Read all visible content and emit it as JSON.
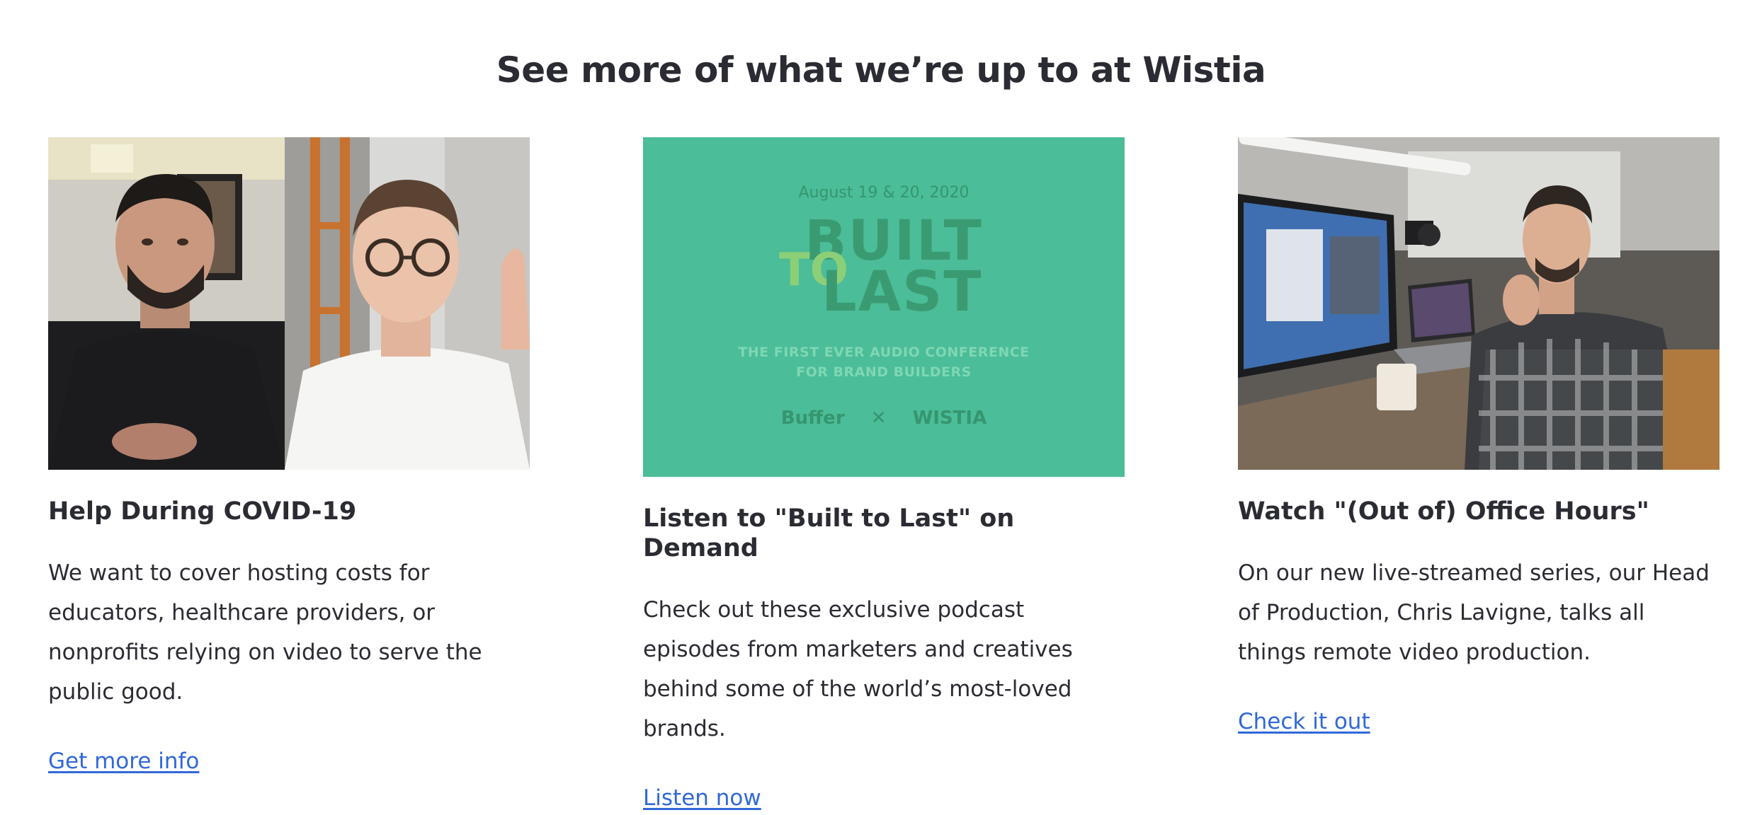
{
  "section": {
    "title": "See more of what we’re up to at Wistia"
  },
  "cards": [
    {
      "image_alt": "Two people on a video call",
      "title": "Help During COVID-19",
      "description": "We want to cover hosting costs for educators, healthcare providers, or nonprofits relying on video to serve the public good.",
      "link": "Get more info"
    },
    {
      "banner": {
        "date": "August 19 & 20, 2020",
        "built": "BUILT",
        "to": "TO",
        "last": "LAST",
        "subtitle_line1": "THE FIRST EVER AUDIO CONFERENCE",
        "subtitle_line2": "FOR BRAND BUILDERS",
        "sponsor1": "Buffer",
        "separator": "✕",
        "sponsor2": "WISTIA"
      },
      "title": "Listen to \"Built to Last\" on Demand",
      "description": "Check out these exclusive podcast episodes from marketers and creatives behind some of the world’s most-loved brands.",
      "link": "Listen now"
    },
    {
      "image_alt": "Person at a desk with monitors and cameras",
      "title": "Watch \"(Out of) Office Hours\"",
      "description": "On our new live-streamed series, our Head of Production, Chris Lavigne, talks all things remote video production.",
      "link": "Check it out"
    }
  ],
  "colors": {
    "heading": "#2b2c33",
    "link": "#3168d8",
    "banner_green": "#4bbd98"
  }
}
